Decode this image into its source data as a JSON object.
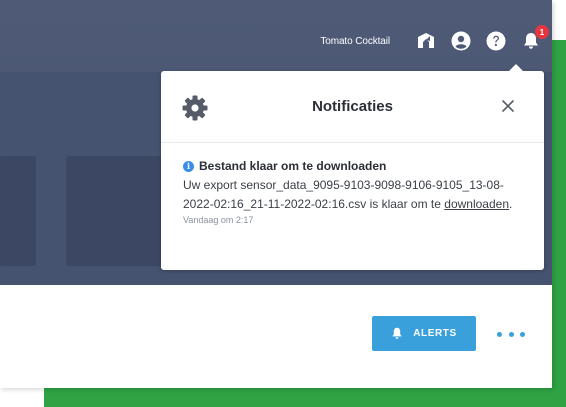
{
  "topbar": {
    "company_name": "Tomato Cocktail",
    "icons": [
      "dashboard-icon",
      "user-icon",
      "help-icon",
      "bell-icon"
    ],
    "notification_count": "1"
  },
  "notifications": {
    "title": "Notificaties",
    "items": [
      {
        "title": "Bestand klaar om te downloaden",
        "body_prefix": "Uw export sensor_data_9095-9103-9098-9106-9105_13-08-2022-02:16_21-11-2022-02:16.csv is klaar om te ",
        "link_text": "downloaden",
        "body_suffix": ".",
        "time": "Vandaag om 2:17"
      }
    ]
  },
  "actions": {
    "alerts_label": "ALERTS"
  },
  "colors": {
    "header_bg": "#4e5a76",
    "accent_blue": "#3aa0dc",
    "badge_red": "#e5373f",
    "frame_green": "#2fa344"
  }
}
